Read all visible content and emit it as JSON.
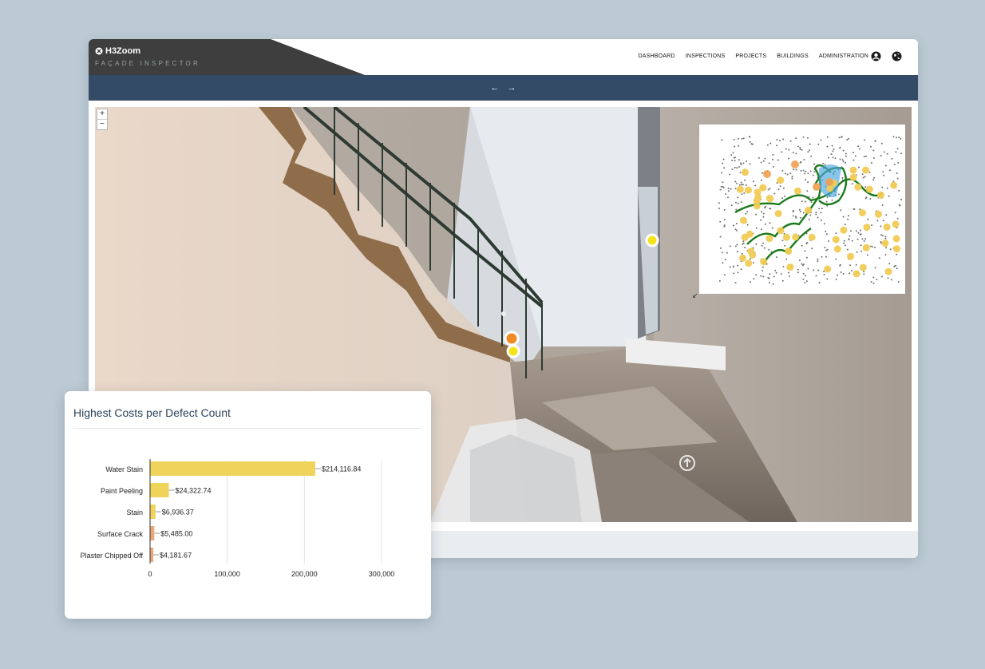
{
  "header": {
    "logo_text": "H3Zoom",
    "subtitle": "FAÇADE INSPECTOR",
    "nav": [
      "DASHBOARD",
      "INSPECTIONS",
      "PROJECTS",
      "BUILDINGS",
      "ADMINISTRATION"
    ],
    "icons": [
      "user-circle-icon",
      "globe-icon"
    ]
  },
  "toolbar": {
    "prev_label": "←",
    "next_label": "→"
  },
  "viewer": {
    "zoom_in_label": "+",
    "zoom_out_label": "−",
    "collapse_minimap_label": "↙",
    "marker_colors": {
      "yellow": "#f5e419",
      "orange": "#f08a24"
    }
  },
  "chart_card": {
    "title": "Highest Costs per Defect Count"
  },
  "chart_data": {
    "type": "bar",
    "orientation": "horizontal",
    "categories": [
      "Water Stain",
      "Paint Peeling",
      "Stain",
      "Surface Crack",
      "Plaster Chipped Off"
    ],
    "values": [
      214116.84,
      24322.74,
      6936.37,
      5485.0,
      4181.67
    ],
    "value_labels": [
      "$214,116.84",
      "$24,322.74",
      "$6,936.37",
      "$5,485.00",
      "$4,181.67"
    ],
    "bar_colors": [
      "#f0d35a",
      "#f0d35a",
      "#f0d35a",
      "#e8a878",
      "#e8a878"
    ],
    "xlim": [
      0,
      300000
    ],
    "xticks": [
      0,
      100000,
      200000,
      300000
    ],
    "xtick_labels": [
      "0",
      "100,000",
      "200,000",
      "300,000"
    ],
    "grid": true
  }
}
